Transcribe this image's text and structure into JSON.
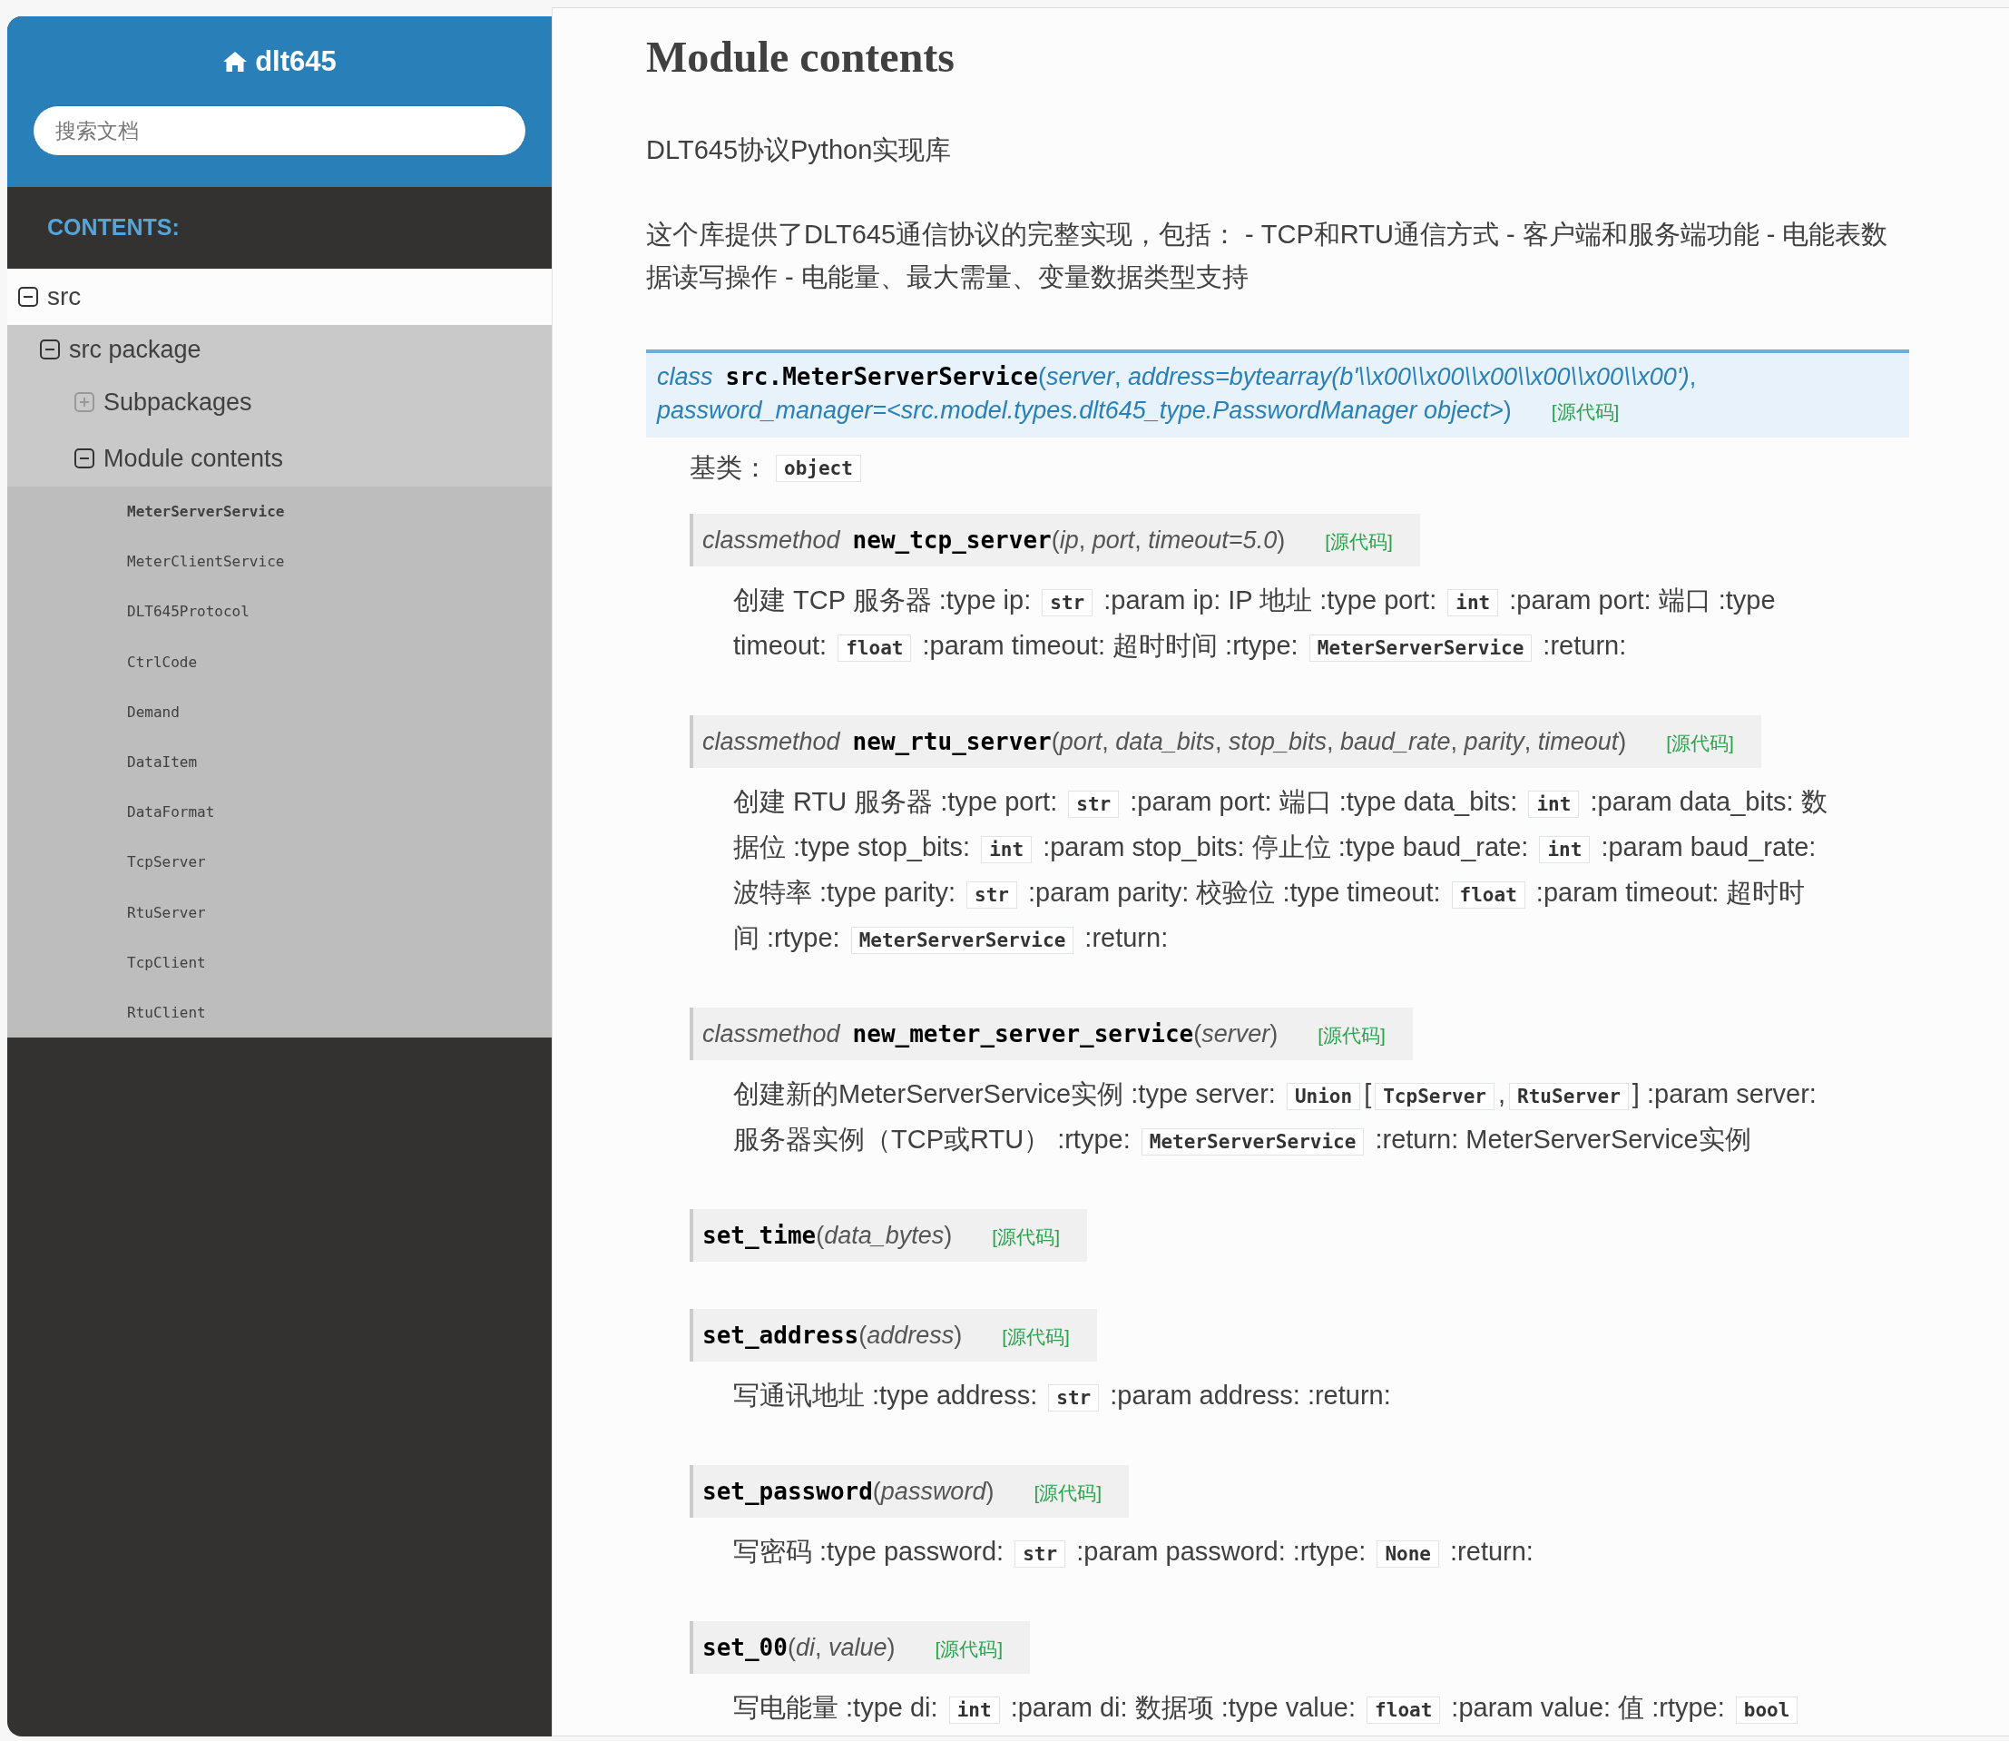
{
  "sidebar": {
    "title": "dlt645",
    "search": {
      "placeholder": "搜索文档"
    },
    "caption": "CONTENTS:",
    "nav": [
      {
        "label": "src",
        "expanded": true,
        "children": [
          {
            "label": "src package",
            "expanded": true,
            "children": [
              {
                "label": "Subpackages",
                "expanded": false
              },
              {
                "label": "Module contents",
                "expanded": true,
                "children": [
                  {
                    "label": "MeterServerService",
                    "selected": true
                  },
                  {
                    "label": "MeterClientService",
                    "selected": false
                  },
                  {
                    "label": "DLT645Protocol",
                    "selected": false
                  },
                  {
                    "label": "CtrlCode",
                    "selected": false
                  },
                  {
                    "label": "Demand",
                    "selected": false
                  },
                  {
                    "label": "DataItem",
                    "selected": false
                  },
                  {
                    "label": "DataFormat",
                    "selected": false
                  },
                  {
                    "label": "TcpServer",
                    "selected": false
                  },
                  {
                    "label": "RtuServer",
                    "selected": false
                  },
                  {
                    "label": "TcpClient",
                    "selected": false
                  },
                  {
                    "label": "RtuClient",
                    "selected": false
                  }
                ]
              }
            ]
          }
        ]
      }
    ]
  },
  "content": {
    "heading": "Module contents",
    "paragraphs": [
      "DLT645协议Python实现库",
      "这个库提供了DLT645通信协议的完整实现，包括： - TCP和RTU通信方式 - 客户端和服务端功能 - 电能表数据读写操作 - 电能量、最大需量、变量数据类型支持"
    ],
    "class": {
      "keyword": "class",
      "name": "src.MeterServerService",
      "params": [
        "(*server*, *address=bytearray(b'\\\\x00\\\\x00\\\\x00\\\\x00\\\\x00\\\\x00')*,",
        "*password_manager=<src.model.types.dlt645_type.PasswordManager object>*)"
      ],
      "source": "[源代码]",
      "bases_label": "基类：",
      "bases": "object",
      "methods": [
        {
          "keyword": "classmethod",
          "name": "new_tcp_server",
          "params": "(*ip*, *port*, *timeout=5.0*)",
          "source": "[源代码]",
          "lines": [
            [
              {
                "kind": "text",
                "text": "创建 TCP 服务器 :type ip: "
              },
              {
                "kind": "code",
                "text": "str"
              },
              {
                "kind": "text",
                "text": " :param ip: IP 地址 :type port: "
              },
              {
                "kind": "code",
                "text": "int"
              },
              {
                "kind": "text",
                "text": " :param port: 端口 :type"
              }
            ],
            [
              {
                "kind": "text",
                "text": "timeout: "
              },
              {
                "kind": "code",
                "text": "float"
              },
              {
                "kind": "text",
                "text": " :param timeout: 超时时间 :rtype: "
              },
              {
                "kind": "code",
                "text": "MeterServerService"
              },
              {
                "kind": "text",
                "text": " :return:"
              }
            ]
          ]
        },
        {
          "keyword": "classmethod",
          "name": "new_rtu_server",
          "params": "(*port*, *data_bits*, *stop_bits*, *baud_rate*, *parity*, *timeout*)",
          "source": "[源代码]",
          "lines": [
            [
              {
                "kind": "text",
                "text": "创建 RTU 服务器 :type port: "
              },
              {
                "kind": "code",
                "text": "str"
              },
              {
                "kind": "text",
                "text": " :param port: 端口 :type data_bits: "
              },
              {
                "kind": "code",
                "text": "int"
              },
              {
                "kind": "text",
                "text": " :param data_bits: 数"
              }
            ],
            [
              {
                "kind": "text",
                "text": "据位 :type stop_bits: "
              },
              {
                "kind": "code",
                "text": "int"
              },
              {
                "kind": "text",
                "text": " :param stop_bits: 停止位 :type baud_rate: "
              },
              {
                "kind": "code",
                "text": "int"
              },
              {
                "kind": "text",
                "text": " :param baud_rate:"
              }
            ],
            [
              {
                "kind": "text",
                "text": "波特率 :type parity: "
              },
              {
                "kind": "code",
                "text": "str"
              },
              {
                "kind": "text",
                "text": " :param parity: 校验位 :type timeout: "
              },
              {
                "kind": "code",
                "text": "float"
              },
              {
                "kind": "text",
                "text": " :param timeout: 超时时"
              }
            ],
            [
              {
                "kind": "text",
                "text": "间 :rtype: "
              },
              {
                "kind": "code",
                "text": "MeterServerService"
              },
              {
                "kind": "text",
                "text": " :return:"
              }
            ]
          ]
        },
        {
          "keyword": "classmethod",
          "name": "new_meter_server_service",
          "params": "(*server*)",
          "source": "[源代码]",
          "lines": [
            [
              {
                "kind": "text",
                "text": "创建新的MeterServerService实例 :type server: "
              },
              {
                "kind": "code",
                "text": "Union"
              },
              {
                "kind": "text",
                "text": "["
              },
              {
                "kind": "code",
                "text": "TcpServer"
              },
              {
                "kind": "text",
                "text": ","
              },
              {
                "kind": "code",
                "text": "RtuServer"
              },
              {
                "kind": "text",
                "text": "] :param server:"
              }
            ],
            [
              {
                "kind": "text",
                "text": "服务器实例（TCP或RTU） :rtype: "
              },
              {
                "kind": "code",
                "text": "MeterServerService"
              },
              {
                "kind": "text",
                "text": " :return: MeterServerService实例"
              }
            ]
          ]
        },
        {
          "name": "set_time",
          "params": "(*data_bytes*)",
          "source": "[源代码]"
        },
        {
          "name": "set_address",
          "params": "(*address*)",
          "source": "[源代码]",
          "lines": [
            [
              {
                "kind": "text",
                "text": "写通讯地址 :type address: "
              },
              {
                "kind": "code",
                "text": "str"
              },
              {
                "kind": "text",
                "text": " :param address: :return:"
              }
            ]
          ]
        },
        {
          "name": "set_password",
          "params": "(*password*)",
          "source": "[源代码]",
          "lines": [
            [
              {
                "kind": "text",
                "text": "写密码 :type password: "
              },
              {
                "kind": "code",
                "text": "str"
              },
              {
                "kind": "text",
                "text": " :param password: :rtype: "
              },
              {
                "kind": "code",
                "text": "None"
              },
              {
                "kind": "text",
                "text": " :return:"
              }
            ]
          ]
        },
        {
          "name": "set_00",
          "params": "(*di*, *value*)",
          "source": "[源代码]",
          "lines": [
            [
              {
                "kind": "text",
                "text": "写电能量 :type di: "
              },
              {
                "kind": "code",
                "text": "int"
              },
              {
                "kind": "text",
                "text": " :param di: 数据项 :type value: "
              },
              {
                "kind": "code",
                "text": "float"
              },
              {
                "kind": "text",
                "text": " :param value: 值 :rtype: "
              },
              {
                "kind": "code",
                "text": "bool"
              }
            ]
          ]
        }
      ]
    }
  }
}
